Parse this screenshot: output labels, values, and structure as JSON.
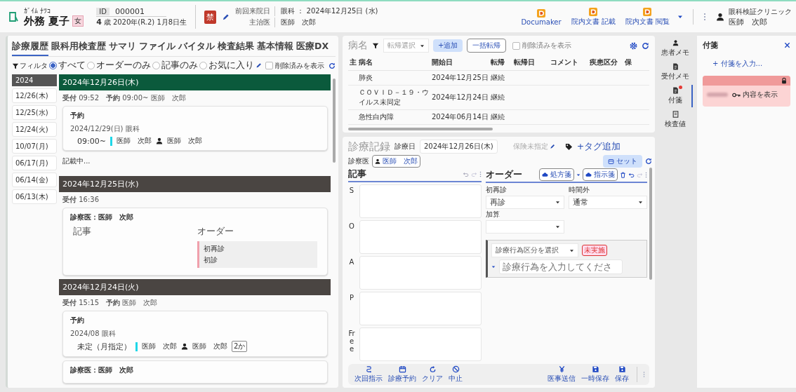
{
  "header": {
    "kana": "ｶﾞｲﾑ ﾅﾂｺ",
    "name": "外務 夏子",
    "sex": "女",
    "id_label": "ID",
    "id": "000001",
    "age": "4",
    "age_unit": "歳",
    "birth": "2020年(R.2) 1月8日生",
    "alert": "禁",
    "last_visit_label": "前回来院日",
    "last_visit": "眼科 ： 2024年12月25日 (水)",
    "doctor_label": "主治医",
    "doctor": "医師　次郎"
  },
  "tools": [
    {
      "label": "Documaker"
    },
    {
      "label": "院内文書 記載"
    },
    {
      "label": "院内文書 閲覧"
    }
  ],
  "user": {
    "clinic": "眼科検証クリニック",
    "name": "医師　次郎"
  },
  "history": {
    "tabs": [
      {
        "label": "診療履歴",
        "selected": true
      },
      {
        "label": "眼科用検査歴",
        "selected": false
      },
      {
        "label": "サマリ",
        "selected": false
      },
      {
        "label": "ファイル",
        "selected": false
      },
      {
        "label": "バイタル",
        "selected": false
      },
      {
        "label": "検査結果",
        "selected": false
      },
      {
        "label": "基本情報",
        "selected": false
      },
      {
        "label": "医療DX",
        "selected": false
      }
    ],
    "filter": {
      "label": "フィルタ",
      "options": [
        {
          "label": "すべて",
          "selected": true
        },
        {
          "label": "オーダーのみ",
          "selected": false
        },
        {
          "label": "記事のみ",
          "selected": false
        },
        {
          "label": "お気に入り",
          "selected": false
        }
      ],
      "show_deleted": {
        "label": "削除済みを表示",
        "checked": false
      }
    },
    "dates": [
      {
        "label": "2024",
        "kind": "year"
      },
      {
        "label": "12/26(木)",
        "kind": "day"
      },
      {
        "label": "12/25(水)",
        "kind": "day"
      },
      {
        "label": "12/24(火)",
        "kind": "day"
      },
      {
        "label": "10/07(月)",
        "kind": "day"
      },
      {
        "label": "06/17(月)",
        "kind": "day"
      },
      {
        "label": "06/14(金)",
        "kind": "day"
      },
      {
        "label": "06/13(木)",
        "kind": "day"
      }
    ],
    "timeline": [
      {
        "date": "2024年12月26日(木)",
        "current": true,
        "meta": "**受付** 09:52　**予約** 09:00~ 医師　次郎",
        "cards": [
          {
            "kind": "reservation",
            "title": "予約",
            "date_line": "2024/12/29(日) 眼科",
            "time": "09:00~",
            "doctor": "医師　次郎",
            "assignee": "医師　次郎"
          }
        ],
        "status": "記載中..."
      },
      {
        "date": "2024年12月25日(水)",
        "current": false,
        "meta": "**受付** 16:36",
        "cards": [
          {
            "kind": "exam",
            "doctor_line": "診察医：医師　次郎",
            "note_label": "記事",
            "order_label": "オーダー",
            "order": {
              "category": "初再診",
              "value": "初診"
            }
          }
        ]
      },
      {
        "date": "2024年12月24日(火)",
        "current": false,
        "meta": "**受付** 15:15　**予約** 医師　次郎",
        "cards": [
          {
            "kind": "reservation",
            "title": "予約",
            "date_line": "2024/08 眼科",
            "time": "未定（月指定）",
            "doctor": "医師　次郎",
            "assignee": "医師　次郎",
            "badge": "2か"
          },
          {
            "kind": "exam",
            "doctor_line": "診察医：医師　次郎"
          }
        ]
      }
    ]
  },
  "diseases": {
    "title": "病名",
    "outcome_select": "転帰選択",
    "add": "+追加",
    "bulk": "一括転帰",
    "show_deleted": {
      "label": "削除済みを表示",
      "checked": false
    },
    "columns": [
      "主",
      "病名",
      "開始日",
      "転帰",
      "転帰日",
      "コメント",
      "疾患区分",
      "保"
    ],
    "rows": [
      [
        "",
        "肺炎",
        "2024年12月25日",
        "継続"
      ],
      [
        "",
        "ＣＯＶＩＤ－１９・ウイルス未同定",
        "2024年12月24日",
        "継続"
      ],
      [
        "",
        "急性白内障",
        "2024年06月14日",
        "継続"
      ]
    ]
  },
  "record": {
    "title": "診療記録",
    "date_label": "診療日",
    "date": "2024年12月26日(木)",
    "insurance": "保険未指定",
    "tag_add": "+タグ追加",
    "doctor_label": "診察医",
    "doctor": "医師　次郎",
    "set": "セット",
    "notes_title": "記事",
    "soap": [
      {
        "label": "S"
      },
      {
        "label": "O"
      },
      {
        "label": "A"
      },
      {
        "label": "P"
      },
      {
        "label": "Free"
      }
    ],
    "order_title": "オーダー",
    "order_buttons": [
      {
        "label": "処方箋"
      },
      {
        "label": "指示箋"
      }
    ],
    "selects": [
      {
        "label": "初再診",
        "value": "再診"
      },
      {
        "label": "時間外",
        "value": "通常"
      },
      {
        "label": "加算"
      }
    ],
    "entry": {
      "category": "診療行為区分を選択",
      "status": "未実施",
      "placeholder": "診療行為を入力してくださ"
    },
    "actions_left": [
      {
        "label": "次回指示",
        "kind": "next"
      },
      {
        "label": "診療予約",
        "kind": "calendar"
      },
      {
        "label": "クリア",
        "kind": "clear"
      },
      {
        "label": "中止",
        "kind": "cancel"
      }
    ],
    "actions_right": [
      {
        "label": "医事送信",
        "kind": "yen"
      },
      {
        "label": "一時保存",
        "kind": "save"
      },
      {
        "label": "保存",
        "kind": "save"
      }
    ]
  },
  "side": [
    {
      "label": "患者メモ",
      "selected": false,
      "alert": false
    },
    {
      "label": "受付メモ",
      "selected": false,
      "alert": false
    },
    {
      "label": "付箋",
      "selected": true,
      "alert": true
    },
    {
      "label": "検査値",
      "selected": false,
      "alert": false
    }
  ],
  "sticky": {
    "title": "付箋",
    "add": "+ 付箋を入力...",
    "notes": [
      {
        "locked": true,
        "action": "内容を表示"
      }
    ]
  }
}
